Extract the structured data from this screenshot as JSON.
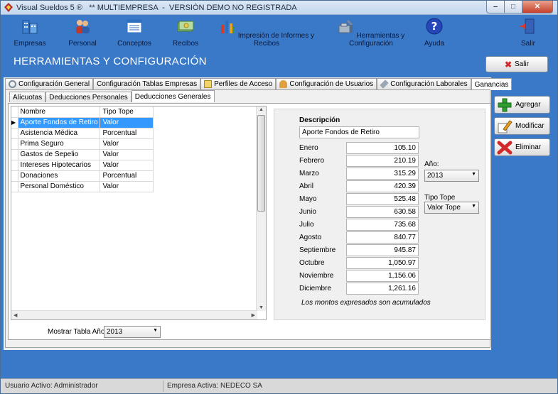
{
  "window": {
    "title": "Visual Sueldos 5 ®   ** MULTIEMPRESA  -  VERSIÓN DEMO NO REGISTRADA"
  },
  "toolbar": {
    "items": [
      {
        "label": "Empresas",
        "icon": "buildings-icon"
      },
      {
        "label": "Personal",
        "icon": "people-icon"
      },
      {
        "label": "Conceptos",
        "icon": "list-icon"
      },
      {
        "label": "Recibos",
        "icon": "money-icon"
      },
      {
        "label": "Impresión de Informes y Recibos",
        "icon": "chart-icon"
      },
      {
        "label": "Herramientas y Configuración",
        "icon": "tools-icon"
      },
      {
        "label": "Ayuda",
        "icon": "help-icon"
      },
      {
        "label": "Salir",
        "icon": "exit-door-icon"
      }
    ]
  },
  "header": {
    "title": "HERRAMIENTAS Y CONFIGURACIÓN",
    "salir": "Salir"
  },
  "tabs": [
    {
      "label": "Configuración General"
    },
    {
      "label": "Configuración Tablas Empresas"
    },
    {
      "label": "Perfiles de Acceso"
    },
    {
      "label": "Configuración de Usuarios"
    },
    {
      "label": "Configuración Laborales"
    },
    {
      "label": "Ganancias"
    }
  ],
  "subtabs": [
    {
      "label": "Alícuotas"
    },
    {
      "label": "Deducciones Personales"
    },
    {
      "label": "Deducciones Generales"
    }
  ],
  "grid": {
    "columns": [
      "Nombre",
      "Tipo Tope"
    ],
    "rows": [
      {
        "nombre": "Aporte Fondos de Retiro",
        "tipo": "Valor"
      },
      {
        "nombre": "Asistencia Médica",
        "tipo": "Porcentual"
      },
      {
        "nombre": "Prima Seguro",
        "tipo": "Valor"
      },
      {
        "nombre": "Gastos de Sepelio",
        "tipo": "Valor"
      },
      {
        "nombre": "Intereses Hipotecarios",
        "tipo": "Valor"
      },
      {
        "nombre": "Donaciones",
        "tipo": "Porcentual"
      },
      {
        "nombre": "Personal Doméstico",
        "tipo": "Valor"
      }
    ]
  },
  "detail": {
    "descripcion_label": "Descripción",
    "descripcion_value": "Aporte Fondos de Retiro",
    "months": [
      {
        "mes": "Enero",
        "valor": "105.10"
      },
      {
        "mes": "Febrero",
        "valor": "210.19"
      },
      {
        "mes": "Marzo",
        "valor": "315.29"
      },
      {
        "mes": "Abril",
        "valor": "420.39"
      },
      {
        "mes": "Mayo",
        "valor": "525.48"
      },
      {
        "mes": "Junio",
        "valor": "630.58"
      },
      {
        "mes": "Julio",
        "valor": "735.68"
      },
      {
        "mes": "Agosto",
        "valor": "840.77"
      },
      {
        "mes": "Septiembre",
        "valor": "945.87"
      },
      {
        "mes": "Octubre",
        "valor": "1,050.97"
      },
      {
        "mes": "Noviembre",
        "valor": "1,156.06"
      },
      {
        "mes": "Diciembre",
        "valor": "1,261.16"
      }
    ],
    "anio_label": "Año:",
    "anio_value": "2013",
    "tipo_tope_label": "Tipo Tope",
    "tipo_tope_value": "Valor Tope",
    "note": "Los montos expresados son acumulados"
  },
  "mostrar": {
    "label": "Mostrar Tabla Año:",
    "value": "2013"
  },
  "side_buttons": {
    "agregar": "Agregar",
    "modificar": "Modificar",
    "eliminar": "Eliminar"
  },
  "status": {
    "usuario": "Usuario Activo: Administrador",
    "empresa": "Empresa Activa: NEDECO SA"
  }
}
